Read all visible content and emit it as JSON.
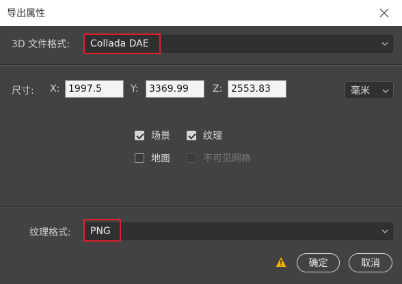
{
  "window": {
    "title": "导出属性"
  },
  "format": {
    "label": "3D 文件格式:",
    "value": "Collada DAE"
  },
  "size": {
    "label": "尺寸:",
    "x_label": "X:",
    "x_value": "1997.5",
    "y_label": "Y:",
    "y_value": "3369.99",
    "z_label": "Z:",
    "z_value": "2553.83",
    "unit": "毫米"
  },
  "options": {
    "scene": {
      "label": "场景",
      "checked": true
    },
    "texture": {
      "label": "纹理",
      "checked": true
    },
    "ground": {
      "label": "地面",
      "checked": false
    },
    "invisible_mesh": {
      "label": "不可见网格",
      "checked": false,
      "disabled": true
    }
  },
  "texture_format": {
    "label": "纹理格式:",
    "value": "PNG"
  },
  "buttons": {
    "ok": "确定",
    "cancel": "取消"
  },
  "colors": {
    "highlight": "#e0202e",
    "warning": "#f0b400",
    "panel": "#424242"
  },
  "icons": {
    "close": "close-icon",
    "warning": "warning-icon",
    "dropdown": "chevron-down-icon"
  }
}
